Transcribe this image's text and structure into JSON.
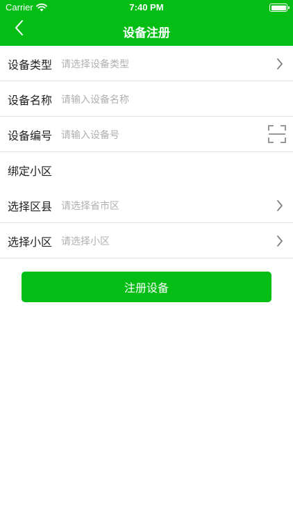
{
  "status_bar": {
    "carrier": "Carrier",
    "time": "7:40 PM"
  },
  "nav": {
    "title": "设备注册",
    "back_icon": "chevron-left-icon"
  },
  "form": {
    "device_type": {
      "label": "设备类型",
      "placeholder": "请选择设备类型"
    },
    "device_name": {
      "label": "设备名称",
      "placeholder": "请输入设备名称"
    },
    "device_number": {
      "label": "设备编号",
      "placeholder": "请输入设备号"
    },
    "bind_community": {
      "label": "绑定小区"
    },
    "select_district": {
      "label": "选择区县",
      "placeholder": "请选择省市区"
    },
    "select_community": {
      "label": "选择小区",
      "placeholder": "请选择小区"
    }
  },
  "actions": {
    "register_label": "注册设备"
  },
  "colors": {
    "brand": "#04BE16",
    "placeholder": "#b0b0b0",
    "divider": "#e2e2e2"
  }
}
